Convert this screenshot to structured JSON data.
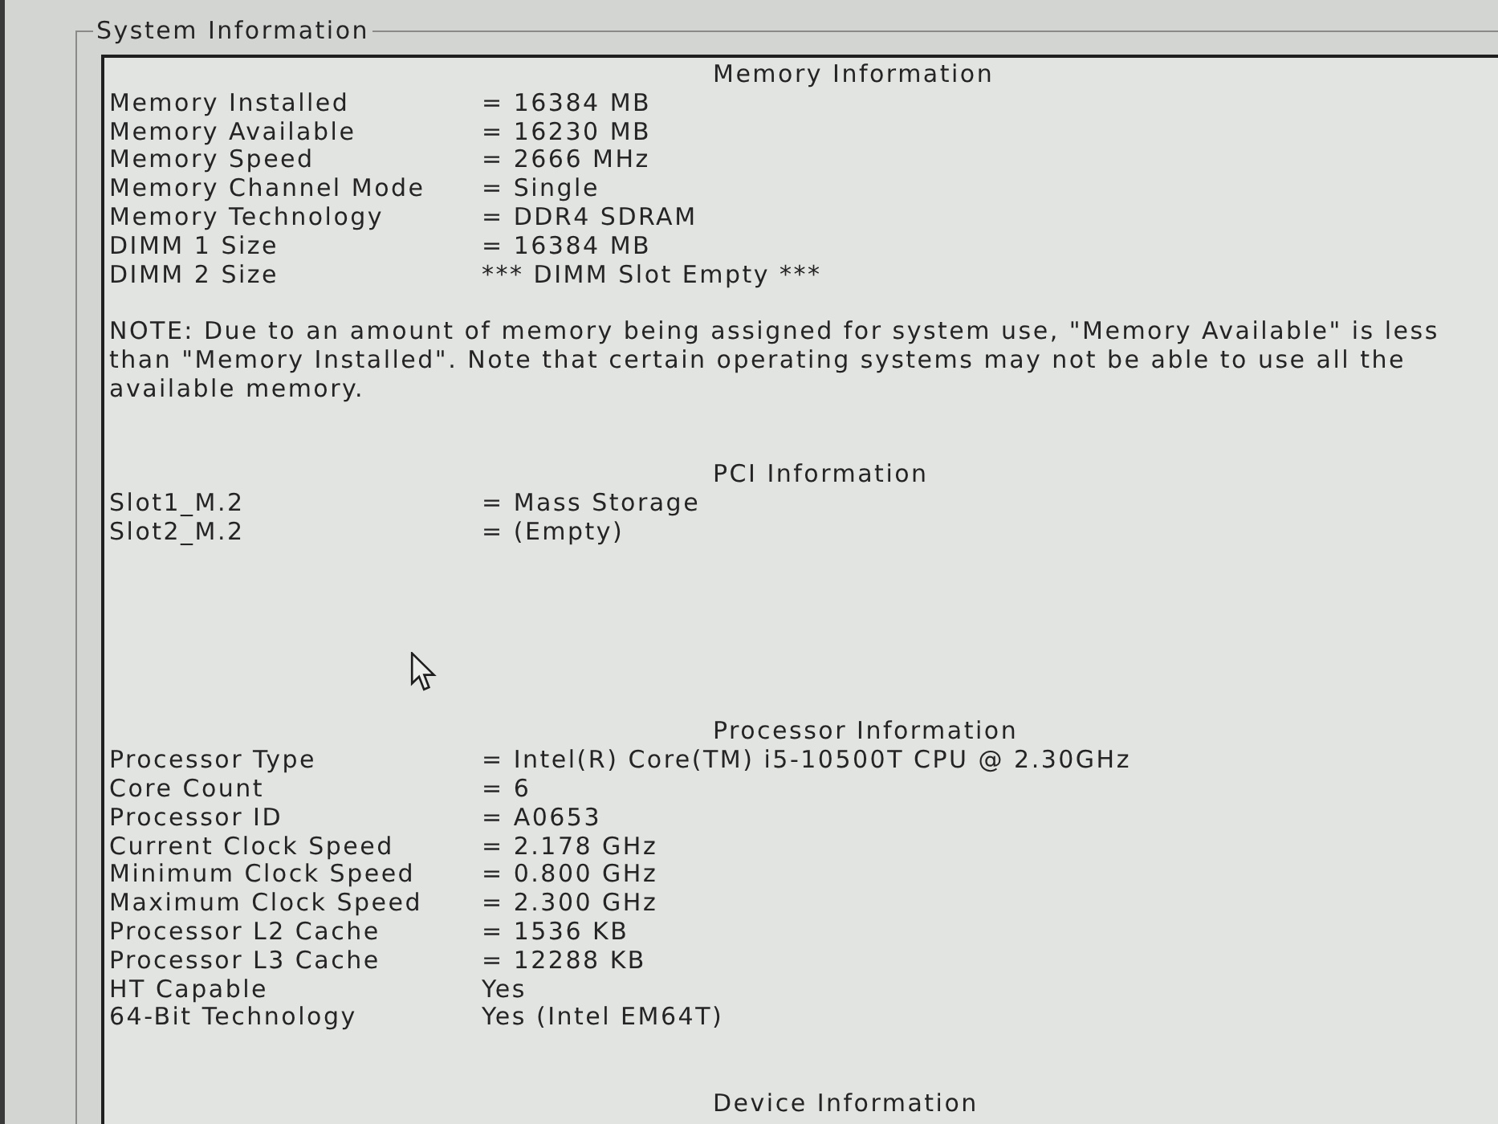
{
  "group_box": {
    "title": "System Information"
  },
  "sections": [
    {
      "heading": "Memory Information",
      "rows": [
        {
          "label": "Memory Installed",
          "value": "= 16384 MB"
        },
        {
          "label": "Memory Available",
          "value": "= 16230 MB"
        },
        {
          "label": "Memory Speed",
          "value": "= 2666 MHz"
        },
        {
          "label": "Memory Channel Mode",
          "value": "= Single"
        },
        {
          "label": "Memory Technology",
          "value": "= DDR4 SDRAM"
        },
        {
          "label": "DIMM 1 Size",
          "value": "= 16384 MB"
        },
        {
          "label": "DIMM 2 Size",
          "value": "*** DIMM Slot Empty ***"
        }
      ],
      "note": "NOTE: Due to an amount of memory being assigned for system use, \"Memory Available\" is less than \"Memory Installed\". Note that certain operating systems may not be able to use all the available memory."
    },
    {
      "heading": "PCI Information",
      "rows": [
        {
          "label": "Slot1_M.2",
          "value": "= Mass Storage"
        },
        {
          "label": "Slot2_M.2",
          "value": "= (Empty)"
        }
      ]
    },
    {
      "heading": "Processor Information",
      "rows": [
        {
          "label": "Processor Type",
          "value": "= Intel(R) Core(TM) i5-10500T CPU @ 2.30GHz"
        },
        {
          "label": "Core Count",
          "value": "= 6"
        },
        {
          "label": "Processor ID",
          "value": "= A0653"
        },
        {
          "label": "Current Clock Speed",
          "value": "= 2.178 GHz"
        },
        {
          "label": "Minimum Clock Speed",
          "value": "= 0.800 GHz"
        },
        {
          "label": "Maximum Clock Speed",
          "value": "= 2.300 GHz"
        },
        {
          "label": "Processor L2 Cache",
          "value": "= 1536 KB"
        },
        {
          "label": "Processor L3 Cache",
          "value": "= 12288 KB"
        },
        {
          "label": "HT Capable",
          "value": "Yes"
        },
        {
          "label": "64-Bit Technology",
          "value": "Yes (Intel EM64T)"
        }
      ]
    },
    {
      "heading": "Device Information"
    }
  ]
}
